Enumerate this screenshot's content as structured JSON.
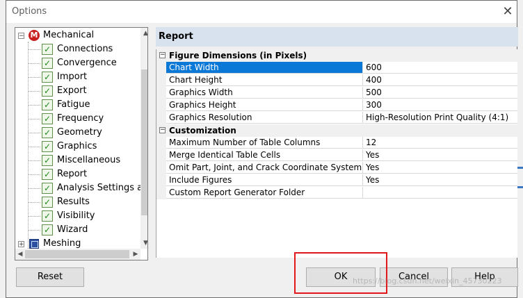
{
  "window": {
    "title": "Options",
    "close_glyph": "✕"
  },
  "tree": {
    "root": {
      "label": "Mechanical",
      "icon": "mechanical-logo-icon",
      "expander": "−"
    },
    "items": [
      {
        "label": "Connections"
      },
      {
        "label": "Convergence"
      },
      {
        "label": "Import"
      },
      {
        "label": "Export"
      },
      {
        "label": "Fatigue"
      },
      {
        "label": "Frequency"
      },
      {
        "label": "Geometry"
      },
      {
        "label": "Graphics"
      },
      {
        "label": "Miscellaneous"
      },
      {
        "label": "Report",
        "selected": true
      },
      {
        "label": "Analysis Settings ar"
      },
      {
        "label": "Results"
      },
      {
        "label": "Visibility"
      },
      {
        "label": "Wizard"
      }
    ],
    "next_root": {
      "label": "Meshing",
      "expander": "+"
    },
    "check_glyph": "✓"
  },
  "panel": {
    "title": "Report",
    "categories": [
      {
        "label": "Figure Dimensions (in Pixels)",
        "toggle": "−",
        "rows": [
          {
            "name": "Chart Width",
            "value": "600",
            "selected": true
          },
          {
            "name": "Chart Height",
            "value": "400"
          },
          {
            "name": "Graphics Width",
            "value": "500"
          },
          {
            "name": "Graphics Height",
            "value": "300"
          },
          {
            "name": "Graphics Resolution",
            "value": "High-Resolution Print Quality (4:1)"
          }
        ]
      },
      {
        "label": "Customization",
        "toggle": "−",
        "rows": [
          {
            "name": "Maximum Number of Table Columns",
            "value": "12"
          },
          {
            "name": "Merge Identical Table Cells",
            "value": "Yes"
          },
          {
            "name": "Omit Part, Joint, and Crack Coordinate System Tables",
            "value": "Yes"
          },
          {
            "name": "Include Figures",
            "value": "Yes"
          },
          {
            "name": "Custom Report Generator Folder",
            "value": ""
          }
        ]
      }
    ]
  },
  "buttons": {
    "reset": "Reset",
    "ok": "OK",
    "cancel": "Cancel",
    "help": "Help"
  },
  "watermark": "https://blog.csdn.net/weixin_45730223",
  "colors": {
    "selection": "#0a78d7",
    "highlight_box": "#e2161b",
    "panel_header": "#d8e2ef"
  }
}
